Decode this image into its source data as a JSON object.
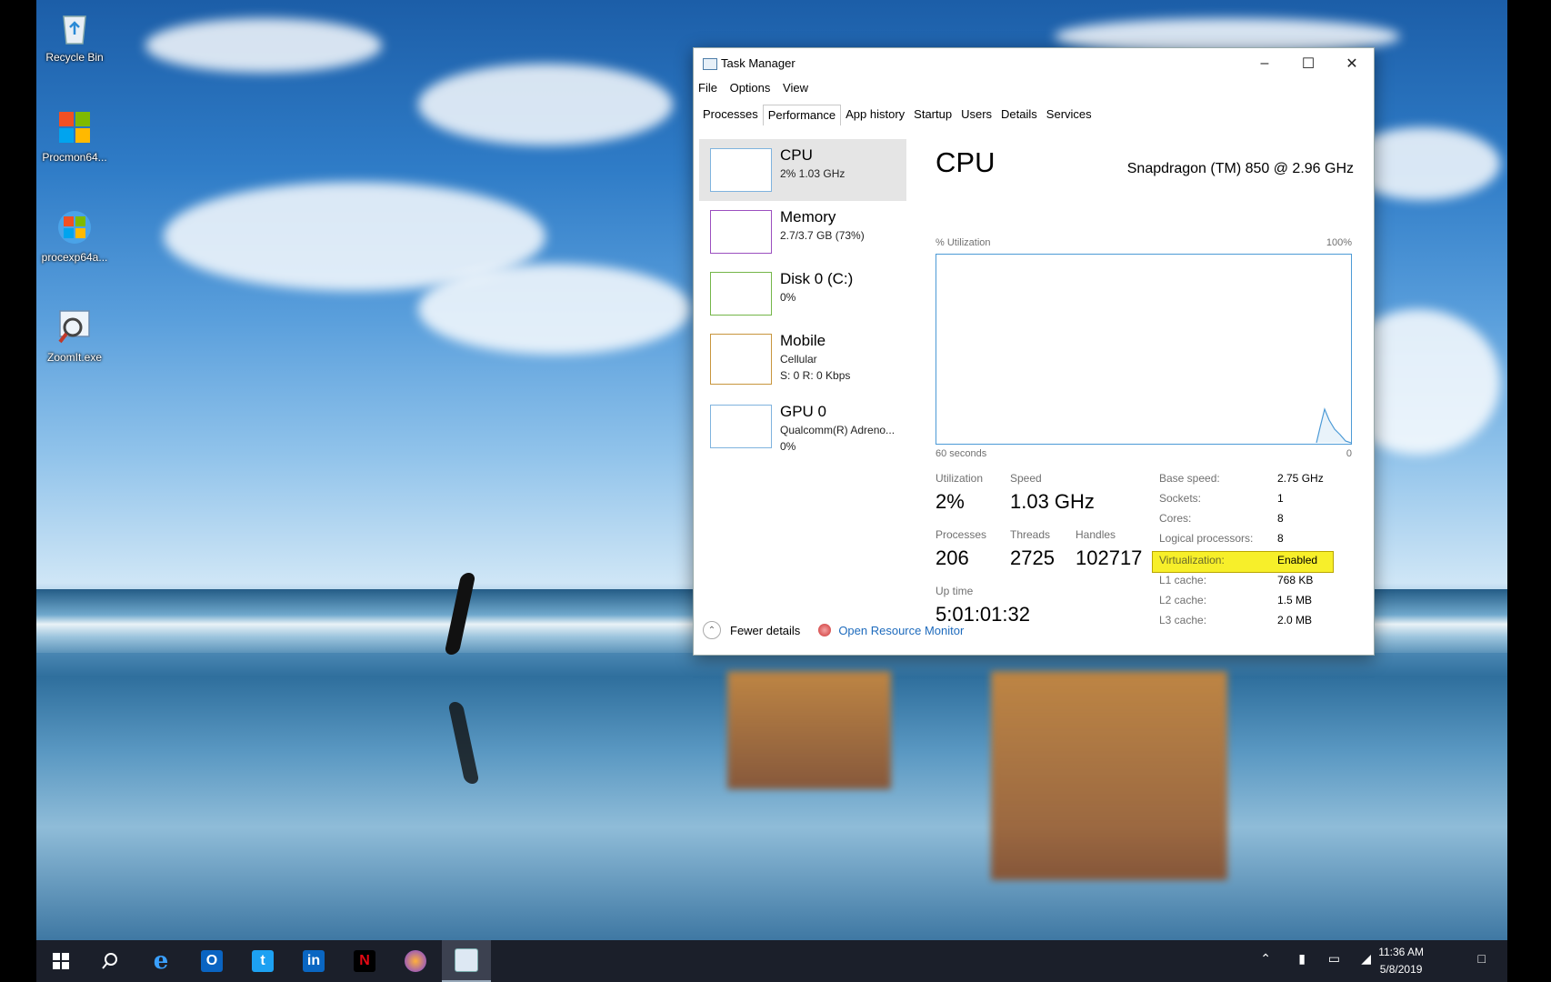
{
  "desktop": {
    "icons": [
      {
        "label": "Recycle Bin",
        "icon": "recycle-bin-icon"
      },
      {
        "label": "Procmon64...",
        "icon": "windows-app-icon"
      },
      {
        "label": "procexp64a...",
        "icon": "windows-app-icon"
      },
      {
        "label": "ZoomIt.exe",
        "icon": "magnifier-icon"
      }
    ]
  },
  "window": {
    "title": "Task Manager",
    "menu": [
      "File",
      "Options",
      "View"
    ],
    "tabs": [
      "Processes",
      "Performance",
      "App history",
      "Startup",
      "Users",
      "Details",
      "Services"
    ],
    "selected_tab": "Performance"
  },
  "sidebar": {
    "items": [
      {
        "name": "CPU",
        "sub": "2%  1.03 GHz",
        "sub2": ""
      },
      {
        "name": "Memory",
        "sub": "2.7/3.7 GB (73%)",
        "sub2": ""
      },
      {
        "name": "Disk 0 (C:)",
        "sub": "0%",
        "sub2": ""
      },
      {
        "name": "Mobile",
        "sub": "Cellular",
        "sub2": "S: 0  R: 0 Kbps"
      },
      {
        "name": "GPU 0",
        "sub": "Qualcomm(R) Adreno...",
        "sub2": "0%"
      }
    ],
    "colors": {
      "cpu": "#7fb3de",
      "memory": "#9b4fbf",
      "disk": "#74b649",
      "mobile": "#c8963d",
      "gpu": "#7fb3de"
    }
  },
  "main": {
    "title": "CPU",
    "model": "Snapdragon (TM) 850 @ 2.96 GHz",
    "graph": {
      "y_label": "% Utilization",
      "y_max_label": "100%",
      "x_left_label": "60 seconds",
      "x_right_label": "0",
      "line_color": "#4c9ad6"
    },
    "stats": {
      "utilization_label": "Utilization",
      "utilization": "2%",
      "speed_label": "Speed",
      "speed": "1.03 GHz",
      "processes_label": "Processes",
      "processes": "206",
      "threads_label": "Threads",
      "threads": "2725",
      "handles_label": "Handles",
      "handles": "102717",
      "uptime_label": "Up time",
      "uptime": "5:01:01:32"
    },
    "info": [
      {
        "key": "Base speed:",
        "value": "2.75 GHz"
      },
      {
        "key": "Sockets:",
        "value": "1"
      },
      {
        "key": "Cores:",
        "value": "8"
      },
      {
        "key": "Logical processors:",
        "value": "8"
      },
      {
        "key": "Virtualization:",
        "value": "Enabled"
      },
      {
        "key": "L1 cache:",
        "value": "768 KB"
      },
      {
        "key": "L2 cache:",
        "value": "1.5 MB"
      },
      {
        "key": "L3 cache:",
        "value": "2.0 MB"
      }
    ],
    "highlight_color": "#f7ef2a"
  },
  "footer": {
    "fewer_details": "Fewer details",
    "open_resource_monitor": "Open Resource Monitor"
  },
  "taskbar": {
    "time": "11:36 AM",
    "date": "5/8/2019",
    "apps": [
      "start-icon",
      "search-icon",
      "edge-icon",
      "outlook-icon",
      "twitter-icon",
      "linkedin-icon",
      "netflix-icon",
      "firefox-icon",
      "task-manager-icon"
    ]
  }
}
